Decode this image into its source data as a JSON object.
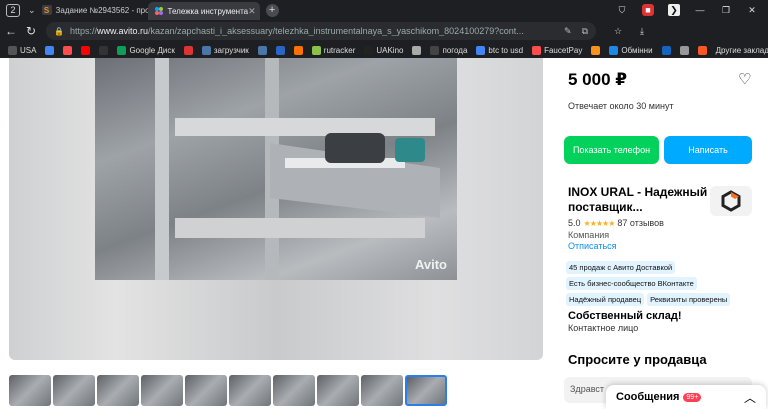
{
  "browser": {
    "tab_count": "2",
    "tabs": [
      {
        "title": "Задание №2943562 - про",
        "favicon": "S"
      },
      {
        "title": "Тележка инструмента",
        "favicon": "avito"
      }
    ],
    "url_domain": "www.avito.ru",
    "url_rest": "/kazan/zapchasti_i_aksessuary/telezhka_instrumentalnaya_s_yaschikom_8024100279?cont...",
    "url_prefix": "https://"
  },
  "bookmarks": [
    {
      "label": "USA",
      "color": "#555"
    },
    {
      "label": "",
      "color": "#4285f4"
    },
    {
      "label": "",
      "color": "#ff4d4d"
    },
    {
      "label": "",
      "color": "#ff0000"
    },
    {
      "label": "",
      "color": "#333"
    },
    {
      "label": "Google Диск",
      "color": "#0f9d58"
    },
    {
      "label": "",
      "color": "#d33"
    },
    {
      "label": "загрузчик",
      "color": "#4a76a8"
    },
    {
      "label": "",
      "color": "#4a76a8"
    },
    {
      "label": "",
      "color": "#2a64c5"
    },
    {
      "label": "",
      "color": "#ff7000"
    },
    {
      "label": "rutracker",
      "color": "#8bc34a"
    },
    {
      "label": "UAKino",
      "color": "#222"
    },
    {
      "label": "",
      "color": "#aaa"
    },
    {
      "label": "погода",
      "color": "#444"
    },
    {
      "label": "btc to usd",
      "color": "#4285f4"
    },
    {
      "label": "FaucetPay",
      "color": "#ff4d4d"
    },
    {
      "label": "",
      "color": "#f7931a"
    },
    {
      "label": "Обмінни",
      "color": "#1e88e5"
    },
    {
      "label": "",
      "color": "#1565c0"
    },
    {
      "label": "",
      "color": "#999"
    },
    {
      "label": "",
      "color": "#ff5722"
    }
  ],
  "other_bookmarks": "Другие закладки",
  "gallery": {
    "watermark": "Avito",
    "thumb_count": 10,
    "selected_thumb": 9
  },
  "listing": {
    "price": "5 000 ₽",
    "responds": "Отвечает около 30 минут",
    "btn_phone": "Показать телефон",
    "btn_write": "Написать",
    "seller_name": "INOX URAL - Надежный поставщик...",
    "rating_value": "5.0",
    "stars": "★★★★★",
    "reviews": "87 отзывов",
    "seller_type": "Компания",
    "subscribe": "Отписаться",
    "badges": [
      "45 продаж с Авито Доставкой",
      "Есть бизнес-сообщество ВКонтакте",
      "Надёжный продавец",
      "Реквизиты проверены"
    ],
    "own_warehouse": "Собственный склад!",
    "contact_person": "Контактное лицо",
    "ask_title": "Спросите у продавца",
    "ask_placeholder": "Здравст"
  },
  "messages": {
    "label": "Сообщения",
    "count": "99+"
  }
}
